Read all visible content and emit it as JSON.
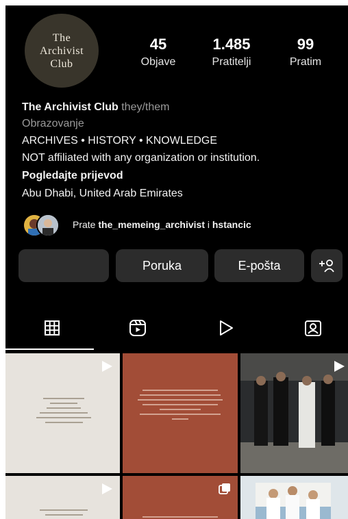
{
  "profile": {
    "avatar_text": "The\nArchivist\nClub",
    "stats": [
      {
        "value": "45",
        "label": "Objave"
      },
      {
        "value": "1.485",
        "label": "Pratitelji"
      },
      {
        "value": "99",
        "label": "Pratim"
      }
    ],
    "name": "The Archivist Club",
    "pronouns": "they/them",
    "category": "Obrazovanje",
    "bio_line1": "ARCHIVES • HISTORY • KNOWLEDGE",
    "bio_line2": "NOT affiliated with any organization or institution.",
    "translate": "Pogledajte prijevod",
    "location": "Abu Dhabi, United Arab Emirates"
  },
  "followed_by": {
    "prefix": "Prate ",
    "user1": "the_memeing_archivist",
    "sep": " i ",
    "user2": "hstancic"
  },
  "buttons": {
    "follow": "",
    "message": "Poruka",
    "email": "E-pošta"
  },
  "tabs": {
    "icons": [
      "grid-icon",
      "reels-icon",
      "play-icon",
      "tagged-icon"
    ]
  },
  "colors": {
    "background": "#000000",
    "button": "#2c2c2c",
    "post_beige": "#e7e3dd",
    "post_rust": "#a24d37"
  }
}
